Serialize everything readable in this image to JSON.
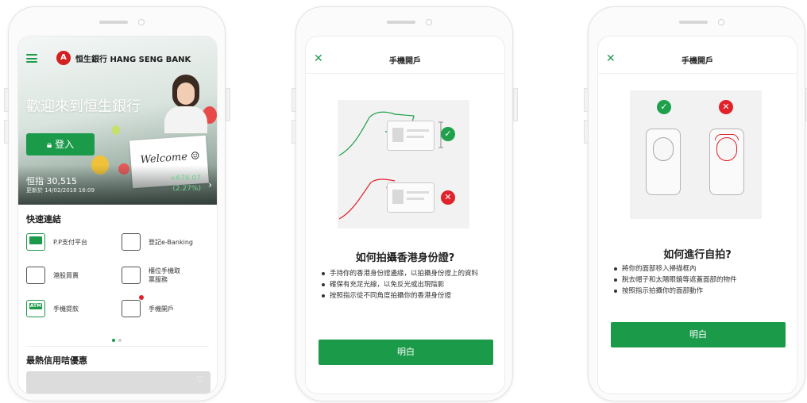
{
  "screen1": {
    "bank_logo_letter": "A",
    "bank_name": "恒生銀行 HANG SENG BANK",
    "welcome": "歡迎來到恒生銀行",
    "login_label": "登入",
    "sign_text": "Welcome ☺",
    "index_label": "恒指 30,515",
    "index_updated": "更新於 14/02/2018 16:09",
    "index_change": "+676.07",
    "index_pct": "(2.27%)",
    "quick_links_title": "快速連結",
    "quick_links": [
      {
        "label": "P.P支付平台",
        "icon": "payment-platform-icon"
      },
      {
        "label": "登記e-Banking",
        "icon": "register-ebanking-icon"
      },
      {
        "label": "港股買賣",
        "icon": "stock-trading-icon"
      },
      {
        "label": "櫃位手機取票服務",
        "line1": "櫃位手機取",
        "line2": "票服務",
        "icon": "queue-ticket-icon"
      },
      {
        "label": "手機提款",
        "icon": "atm-icon",
        "icon_text": "ATM"
      },
      {
        "label": "手機開戶",
        "icon": "bank-building-icon"
      }
    ],
    "pager": {
      "pages": 2,
      "current": 1
    },
    "hot_offers_title": "最熱信用咭優惠",
    "colors": {
      "brand_green": "#1b9a4a",
      "bank_red": "#d32020"
    }
  },
  "screen2": {
    "nav_title": "手機開戶",
    "title": "如何拍攝香港身份證?",
    "bullets": [
      "手持你的香港身份證邊緣，以拍攝身份證上的資料",
      "確保有充足光線，以免反光或出現陰影",
      "按照指示從不同角度拍攝你的香港身份證"
    ],
    "button_label": "明白"
  },
  "screen3": {
    "nav_title": "手機開戶",
    "title": "如何進行自拍?",
    "bullets": [
      "將你的面部移入掃描框內",
      "脫去帽子和太陽眼鏡等遮蓋面部的物件",
      "按照指示拍攝你的面部動作"
    ],
    "button_label": "明白"
  }
}
